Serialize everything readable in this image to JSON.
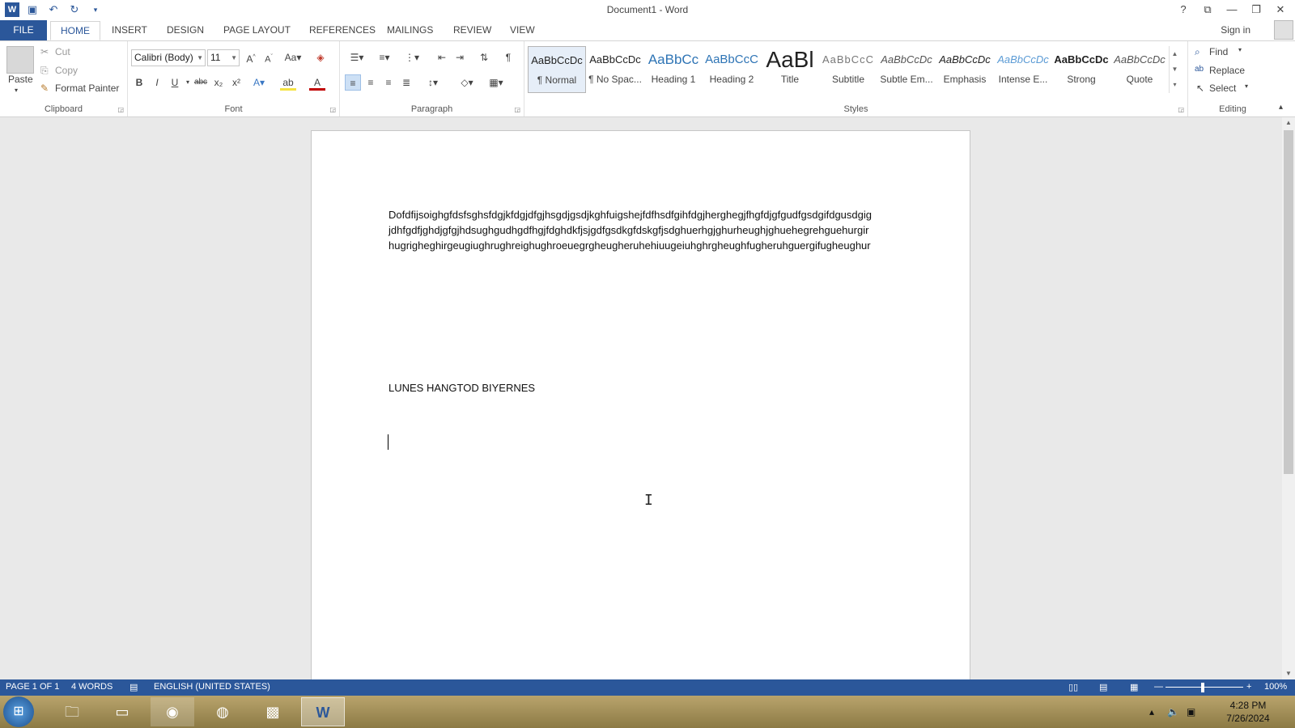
{
  "window": {
    "title": "Document1 - Word"
  },
  "qat": {
    "app_icon": "W",
    "save_icon": "save-icon",
    "undo_icon": "undo-icon",
    "redo_icon": "redo-icon",
    "customize_icon": "customize-icon"
  },
  "winctl": {
    "help": "?",
    "ribbon_opts": "⧉",
    "minimize": "—",
    "restore": "❐",
    "close": "✕"
  },
  "tabs": {
    "file": "FILE",
    "home": "HOME",
    "insert": "INSERT",
    "design": "DESIGN",
    "page_layout": "PAGE LAYOUT",
    "references": "REFERENCES",
    "mailings": "MAILINGS",
    "review": "REVIEW",
    "view": "VIEW"
  },
  "account": {
    "sign_in": "Sign in"
  },
  "clipboard": {
    "paste": "Paste",
    "cut": "Cut",
    "copy": "Copy",
    "format_painter": "Format Painter",
    "label": "Clipboard"
  },
  "font": {
    "name": "Calibri (Body)",
    "size": "11",
    "label": "Font"
  },
  "paragraph": {
    "label": "Paragraph"
  },
  "styles": {
    "label": "Styles",
    "items": [
      {
        "preview": "AaBbCcDc",
        "name": "¶ Normal"
      },
      {
        "preview": "AaBbCcDc",
        "name": "¶ No Spac..."
      },
      {
        "preview": "AaBbCc",
        "name": "Heading 1"
      },
      {
        "preview": "AaBbCcC",
        "name": "Heading 2"
      },
      {
        "preview": "AaBl",
        "name": "Title"
      },
      {
        "preview": "AaBbCcC",
        "name": "Subtitle"
      },
      {
        "preview": "AaBbCcDc",
        "name": "Subtle Em..."
      },
      {
        "preview": "AaBbCcDc",
        "name": "Emphasis"
      },
      {
        "preview": "AaBbCcDc",
        "name": "Intense E..."
      },
      {
        "preview": "AaBbCcDc",
        "name": "Strong"
      },
      {
        "preview": "AaBbCcDc",
        "name": "Quote"
      }
    ]
  },
  "editing": {
    "find": "Find",
    "replace": "Replace",
    "select": "Select",
    "label": "Editing"
  },
  "document": {
    "line1": "Dofdfijsoighgfdsfsghsfdgjkfdgjdfgjhsgdjgsdjkghfuigshejfdfhsdfgihfdgjherghegjfhgfdjgfgudfgsdgifdgusdgig",
    "line2": "jdhfgdfjghdjgfgjhdsughgudhgdfhgjfdghdkfjsjgdfgsdkgfdskgfjsdghuerhgjghurheughjghuehegrehguehurgir",
    "line3": "hugrigheghirgeugiughrughreighughroeuegrgheugheruhehiuugeiuhghrgheughfugheruhguergifugheughur",
    "line4": "LUNES HANGTOD BIYERNES"
  },
  "status": {
    "page": "PAGE 1 OF 1",
    "words": "4 WORDS",
    "language": "ENGLISH (UNITED STATES)",
    "zoom": "100%"
  },
  "taskbar": {
    "time": "4:28 PM",
    "date": "7/26/2024"
  },
  "colors": {
    "accent": "#2b579a"
  }
}
